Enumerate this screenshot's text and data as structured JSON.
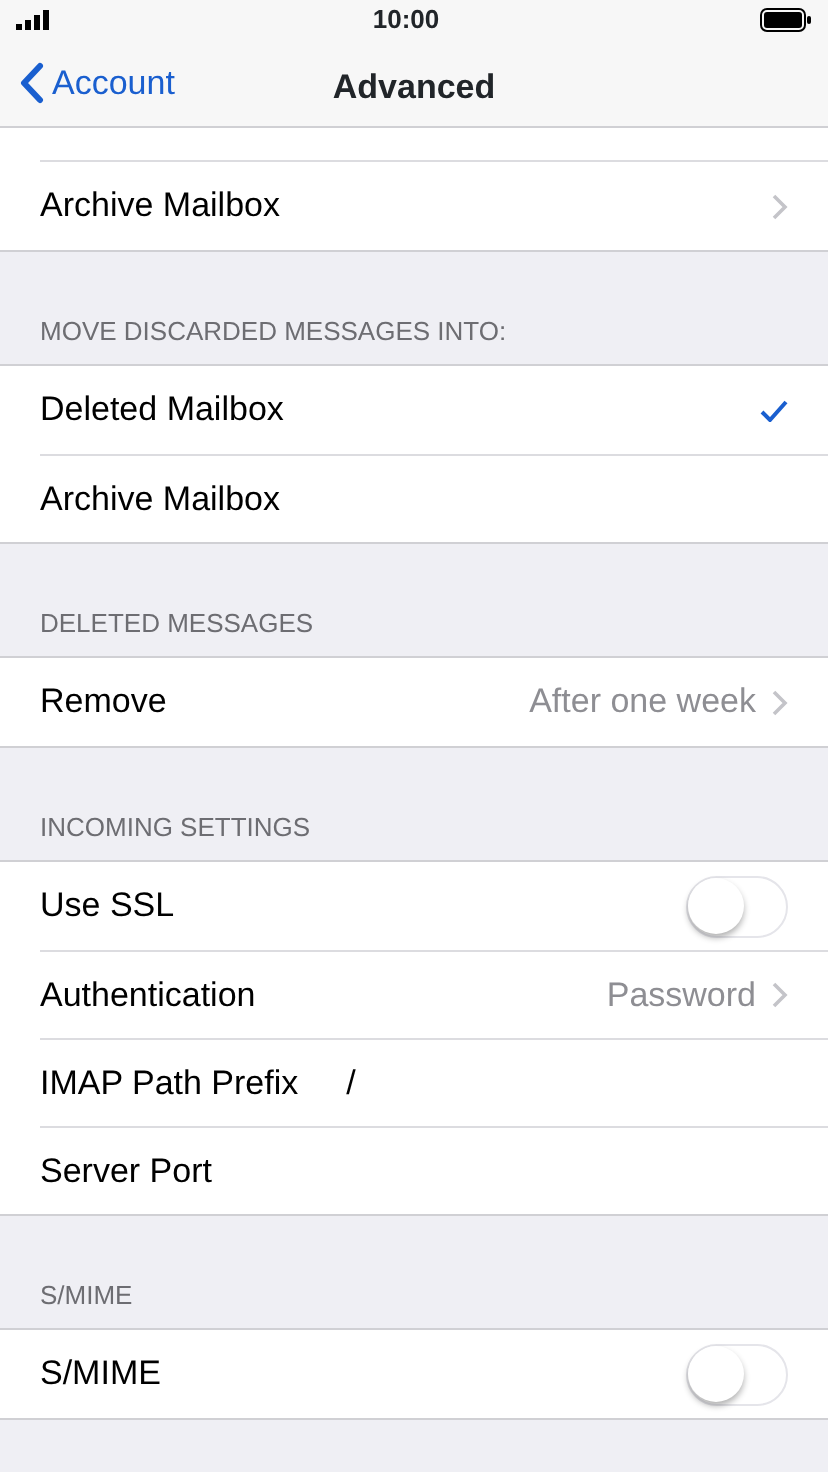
{
  "status_bar": {
    "time": "10:00"
  },
  "nav": {
    "back": "Account",
    "title": "Advanced"
  },
  "sections": [
    {
      "rows": [
        {
          "kind": "link",
          "label": "Archive Mailbox"
        }
      ]
    },
    {
      "header": "MOVE DISCARDED MESSAGES INTO:",
      "rows": [
        {
          "kind": "check",
          "label": "Deleted Mailbox",
          "checked": true
        },
        {
          "kind": "check",
          "label": "Archive Mailbox",
          "checked": false
        }
      ]
    },
    {
      "header": "DELETED MESSAGES",
      "rows": [
        {
          "kind": "link",
          "label": "Remove",
          "value": "After one week"
        }
      ]
    },
    {
      "header": "INCOMING SETTINGS",
      "rows": [
        {
          "kind": "toggle",
          "label": "Use SSL",
          "on": false
        },
        {
          "kind": "link",
          "label": "Authentication",
          "value": "Password"
        },
        {
          "kind": "field",
          "label": "IMAP Path Prefix",
          "value": "/"
        },
        {
          "kind": "field",
          "label": "Server Port"
        }
      ]
    },
    {
      "header": "S/MIME",
      "rows": [
        {
          "kind": "toggle",
          "label": "S/MIME",
          "on": false
        }
      ]
    }
  ]
}
